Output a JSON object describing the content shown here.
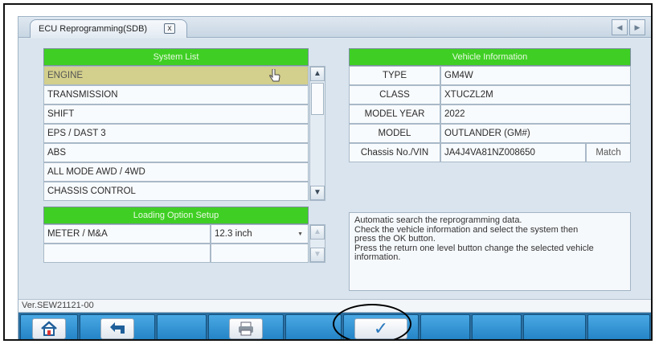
{
  "tab": {
    "title": "ECU Reprogramming(SDB)",
    "close_glyph": "x"
  },
  "nav": {
    "prev_glyph": "◀",
    "next_glyph": "▶"
  },
  "system_list": {
    "header": "System List",
    "items": [
      "ENGINE",
      "TRANSMISSION",
      "SHIFT",
      "EPS / DAST 3",
      "ABS",
      "ALL MODE AWD / 4WD",
      "CHASSIS CONTROL"
    ],
    "selected_index": 0
  },
  "loading_option": {
    "header": "Loading Option Setup",
    "rows": [
      {
        "name": "METER / M&A",
        "value": "12.3 inch"
      },
      {
        "name": "",
        "value": ""
      }
    ]
  },
  "vehicle_info": {
    "header": "Vehicle Information",
    "rows": [
      {
        "label": "TYPE",
        "value": "GM4W"
      },
      {
        "label": "CLASS",
        "value": "XTUCZL2M"
      },
      {
        "label": "MODEL YEAR",
        "value": "2022"
      },
      {
        "label": "MODEL",
        "value": "OUTLANDER (GM#)"
      },
      {
        "label": "Chassis No./VIN",
        "value": "JA4J4VA81NZ008650"
      }
    ],
    "match_label": "Match"
  },
  "message": "Automatic search the reprogramming data.\nCheck the vehicle information and select the system then\npress the OK button.\nPress the return one level button change the selected vehicle\ninformation.",
  "status": {
    "version": "Ver.SEW21121-00"
  },
  "toolbar": {
    "home_icon": "home-icon",
    "return_icon": "return-icon",
    "print_icon": "printer-icon",
    "ok_icon": "checkmark-icon",
    "ok_glyph": "✓",
    "return_glyph": "⮤",
    "home_glyph": "⌂",
    "print_glyph": "⎙"
  },
  "colors": {
    "header_green": "#3fcf24",
    "selected_row": "#d3cf8c",
    "toolbar_blue": "#2c6fa0"
  }
}
